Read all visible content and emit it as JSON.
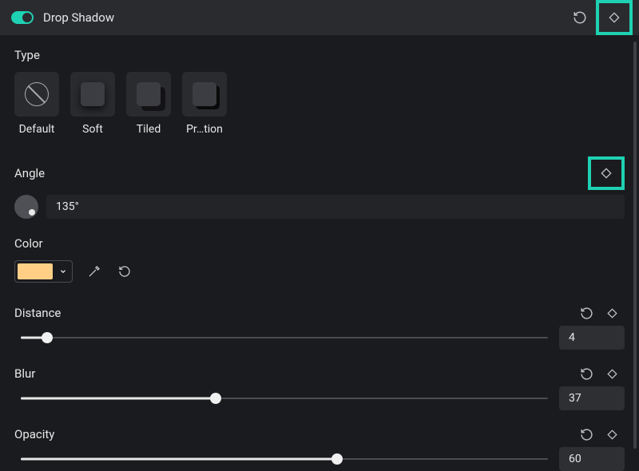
{
  "header": {
    "title": "Drop Shadow",
    "toggle_on": true
  },
  "type": {
    "label": "Type",
    "items": [
      {
        "id": "default",
        "label": "Default"
      },
      {
        "id": "soft",
        "label": "Soft"
      },
      {
        "id": "tiled",
        "label": "Tiled"
      },
      {
        "id": "projection",
        "label": "Pr…tion"
      }
    ]
  },
  "angle": {
    "label": "Angle",
    "value": "135°"
  },
  "color": {
    "label": "Color",
    "hex": "#ffcf86"
  },
  "distance": {
    "label": "Distance",
    "value": "4",
    "percent": 5
  },
  "blur": {
    "label": "Blur",
    "value": "37",
    "percent": 37
  },
  "opacity": {
    "label": "Opacity",
    "value": "60",
    "percent": 60
  }
}
